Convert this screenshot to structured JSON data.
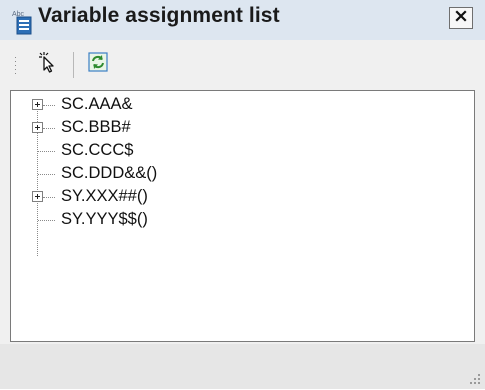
{
  "window": {
    "title": "Variable assignment list",
    "title_icon": "list-document-icon",
    "close_icon": "close-icon"
  },
  "toolbar": {
    "buttons": [
      {
        "icon": "pointer-select-icon"
      },
      {
        "icon": "refresh-icon"
      }
    ]
  },
  "tree": {
    "items": [
      {
        "label": "SC.AAA&",
        "expandable": true
      },
      {
        "label": "SC.BBB#",
        "expandable": true
      },
      {
        "label": "SC.CCC$",
        "expandable": false
      },
      {
        "label": "SC.DDD&&()",
        "expandable": false
      },
      {
        "label": "SY.XXX##()",
        "expandable": true
      },
      {
        "label": "SY.YYY$$()",
        "expandable": false
      }
    ]
  },
  "colors": {
    "titlebar": "#dde6f0",
    "background": "#f0f0f0",
    "tree_background": "#ffffff",
    "statusbar": "#e6e6e6"
  }
}
